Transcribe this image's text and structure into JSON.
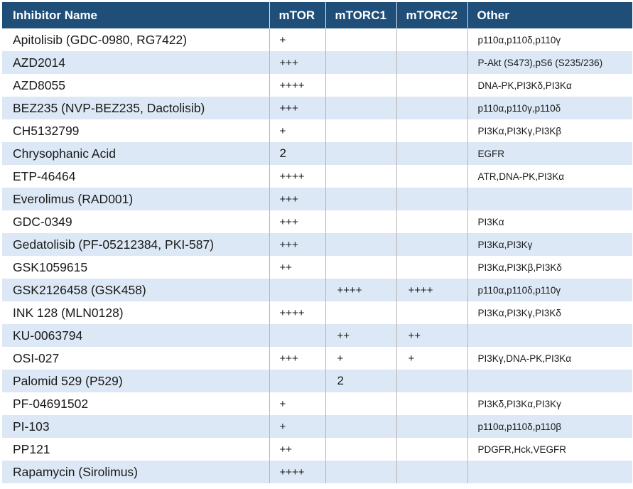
{
  "table": {
    "headers": [
      "Inhibitor Name",
      "mTOR",
      "mTORC1",
      "mTORC2",
      "Other"
    ],
    "rows": [
      {
        "name": "Apitolisib (GDC-0980, RG7422)",
        "mtor": "+",
        "mtorc1": "",
        "mtorc2": "",
        "other": "p110α,p110δ,p110γ"
      },
      {
        "name": "AZD2014",
        "mtor": "+++",
        "mtorc1": "",
        "mtorc2": "",
        "other": "P-Akt (S473),pS6 (S235/236)"
      },
      {
        "name": "AZD8055",
        "mtor": "++++",
        "mtorc1": "",
        "mtorc2": "",
        "other": "DNA-PK,PI3Kδ,PI3Kα"
      },
      {
        "name": "BEZ235 (NVP-BEZ235, Dactolisib)",
        "mtor": "+++",
        "mtorc1": "",
        "mtorc2": "",
        "other": "p110α,p110γ,p110δ"
      },
      {
        "name": "CH5132799",
        "mtor": "+",
        "mtorc1": "",
        "mtorc2": "",
        "other": "PI3Kα,PI3Kγ,PI3Kβ"
      },
      {
        "name": "Chrysophanic Acid",
        "mtor": "2",
        "mtorc1": "",
        "mtorc2": "",
        "other": "EGFR"
      },
      {
        "name": "ETP-46464",
        "mtor": "++++",
        "mtorc1": "",
        "mtorc2": "",
        "other": "ATR,DNA-PK,PI3Kα"
      },
      {
        "name": "Everolimus (RAD001)",
        "mtor": "+++",
        "mtorc1": "",
        "mtorc2": "",
        "other": ""
      },
      {
        "name": "GDC-0349",
        "mtor": "+++",
        "mtorc1": "",
        "mtorc2": "",
        "other": "PI3Kα"
      },
      {
        "name": "Gedatolisib (PF-05212384, PKI-587)",
        "mtor": "+++",
        "mtorc1": "",
        "mtorc2": "",
        "other": "PI3Kα,PI3Kγ"
      },
      {
        "name": "GSK1059615",
        "mtor": "++",
        "mtorc1": "",
        "mtorc2": "",
        "other": "PI3Kα,PI3Kβ,PI3Kδ"
      },
      {
        "name": "GSK2126458 (GSK458)",
        "mtor": "",
        "mtorc1": "++++",
        "mtorc2": "++++",
        "other": "p110α,p110δ,p110γ"
      },
      {
        "name": "INK 128 (MLN0128)",
        "mtor": "++++",
        "mtorc1": "",
        "mtorc2": "",
        "other": "PI3Kα,PI3Kγ,PI3Kδ"
      },
      {
        "name": "KU-0063794",
        "mtor": "",
        "mtorc1": "++",
        "mtorc2": "++",
        "other": ""
      },
      {
        "name": "OSI-027",
        "mtor": "+++",
        "mtorc1": "+",
        "mtorc2": "+",
        "other": "PI3Kγ,DNA-PK,PI3Kα"
      },
      {
        "name": "Palomid 529 (P529)",
        "mtor": "",
        "mtorc1": "2",
        "mtorc2": "",
        "other": ""
      },
      {
        "name": "PF-04691502",
        "mtor": "+",
        "mtorc1": "",
        "mtorc2": "",
        "other": "PI3Kδ,PI3Kα,PI3Kγ"
      },
      {
        "name": "PI-103",
        "mtor": "+",
        "mtorc1": "",
        "mtorc2": "",
        "other": "p110α,p110δ,p110β"
      },
      {
        "name": "PP121",
        "mtor": "++",
        "mtorc1": "",
        "mtorc2": "",
        "other": "PDGFR,Hck,VEGFR"
      },
      {
        "name": "Rapamycin (Sirolimus)",
        "mtor": "++++",
        "mtorc1": "",
        "mtorc2": "",
        "other": ""
      }
    ]
  },
  "colors": {
    "header_bg": "#1f4e79",
    "header_text": "#ffffff",
    "row_stripe": "#dce8f5"
  }
}
